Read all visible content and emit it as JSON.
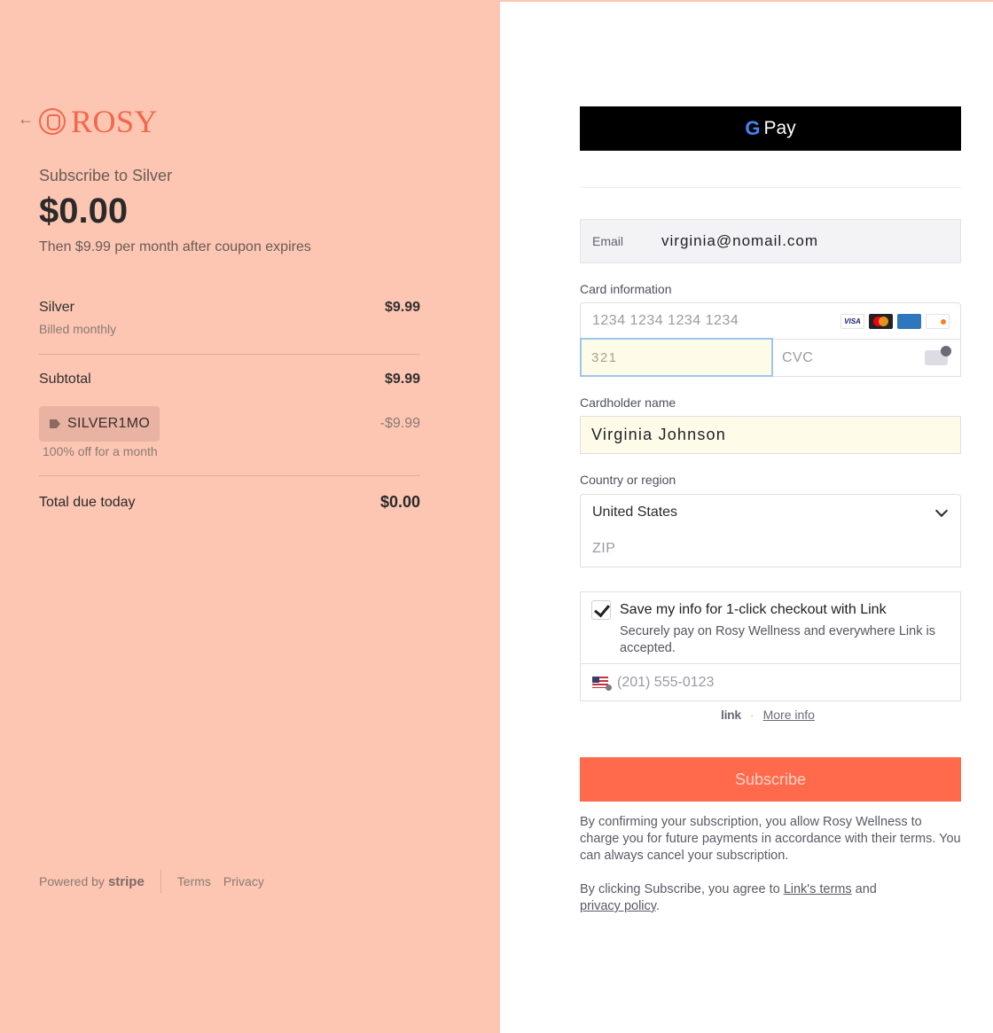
{
  "brand": {
    "name": "ROSY",
    "color": "#f2674a"
  },
  "summary": {
    "subscribe_to": "Subscribe to Silver",
    "amount": "$0.00",
    "note": "Then $9.99 per month after coupon expires",
    "items": [
      {
        "name": "Silver",
        "sub": "Billed monthly",
        "price": "$9.99"
      }
    ],
    "subtotal_label": "Subtotal",
    "subtotal_value": "$9.99",
    "coupon": {
      "code": "SILVER1MO",
      "discount": "-$9.99",
      "description": "100% off for a month"
    },
    "total_label": "Total due today",
    "total_value": "$0.00"
  },
  "footer": {
    "powered_by": "Powered by",
    "stripe": "stripe",
    "terms": "Terms",
    "privacy": "Privacy"
  },
  "payment": {
    "gpay_label": "Pay",
    "email_label": "Email",
    "email_value": "virginia@nomail.com",
    "card_section": "Card information",
    "card_placeholder": "1234 1234 1234 1234",
    "card_brands": [
      "VISA",
      "mastercard",
      "amex",
      "discover"
    ],
    "expiry_value": "321",
    "cvc_placeholder": "CVC",
    "cardholder_label": "Cardholder name",
    "cardholder_value": "Virginia Johnson",
    "country_label": "Country or region",
    "country_value": "United States",
    "zip_placeholder": "ZIP",
    "link_save_title": "Save my info for 1-click checkout with Link",
    "link_save_checked": true,
    "link_save_desc": "Securely pay on Rosy Wellness and everywhere Link is accepted.",
    "phone_placeholder": "(201) 555-0123",
    "link_logo": "link",
    "more_info": "More info",
    "subscribe_label": "Subscribe",
    "legal_1": "By confirming your subscription, you allow Rosy Wellness to charge you for future payments in accordance with their terms. You can always cancel your subscription.",
    "legal_2_prefix": "By clicking Subscribe, you agree to ",
    "legal_2_link1": "Link's terms",
    "legal_2_mid": " and ",
    "legal_2_link2": "privacy policy",
    "legal_2_suffix": "."
  },
  "colors": {
    "left_bg": "#fdc6b2",
    "subscribe_button": "#ff6a4d",
    "gpay_button": "#000000"
  }
}
